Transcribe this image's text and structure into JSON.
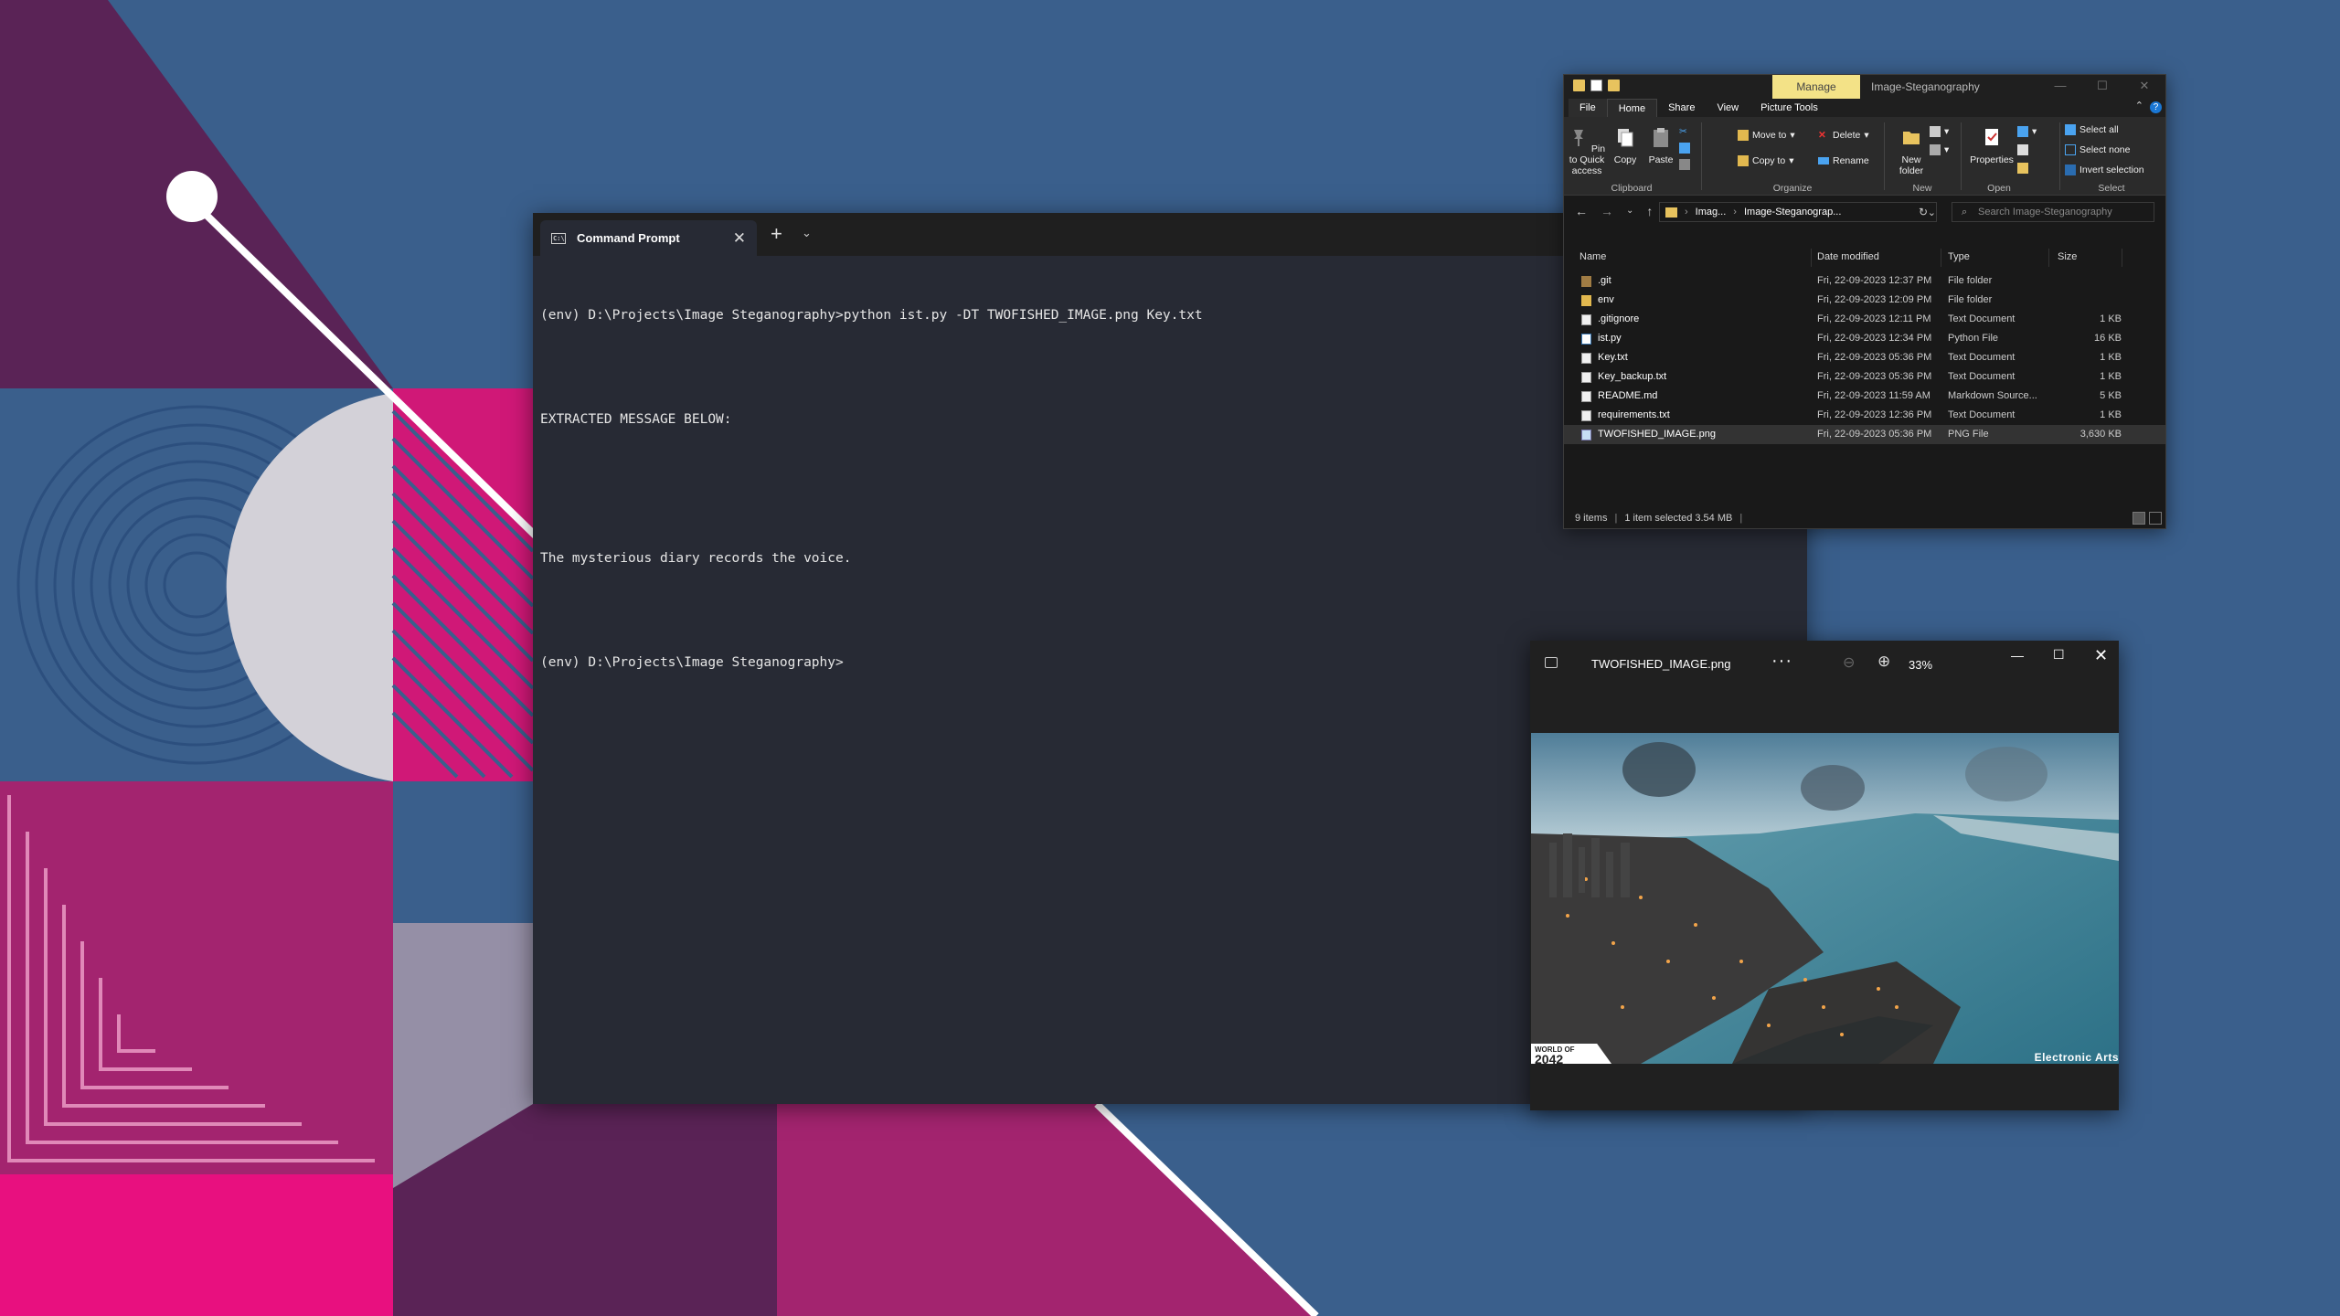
{
  "terminal": {
    "tab_title": "Command Prompt",
    "lines": [
      "(env) D:\\Projects\\Image Steganography>python ist.py -DT TWOFISHED_IMAGE.png Key.txt",
      "EXTRACTED MESSAGE BELOW:",
      "The mysterious diary records the voice.",
      "(env) D:\\Projects\\Image Steganography>"
    ]
  },
  "explorer": {
    "contextual_tab": "Manage",
    "window_title": "Image-Steganography",
    "tabs": [
      "File",
      "Home",
      "Share",
      "View",
      "Picture Tools"
    ],
    "ribbon": {
      "pin": "Pin to Quick access",
      "copy": "Copy",
      "paste": "Paste",
      "move_to": "Move to",
      "copy_to": "Copy to",
      "delete": "Delete",
      "rename": "Rename",
      "new_folder": "New folder",
      "properties": "Properties",
      "select_all": "Select all",
      "select_none": "Select none",
      "invert_selection": "Invert selection",
      "groups": [
        "Clipboard",
        "Organize",
        "New",
        "Open",
        "Select"
      ]
    },
    "address": {
      "crumb1": "Imag...",
      "crumb2": "Image-Steganograp...",
      "search_placeholder": "Search Image-Steganography"
    },
    "columns": [
      "Name",
      "Date modified",
      "Type",
      "Size"
    ],
    "rows": [
      {
        "name": ".git",
        "date": "Fri, 22-09-2023 12:37 PM",
        "type": "File folder",
        "size": "",
        "icon": "folder"
      },
      {
        "name": "env",
        "date": "Fri, 22-09-2023 12:09 PM",
        "type": "File folder",
        "size": "",
        "icon": "folder"
      },
      {
        "name": ".gitignore",
        "date": "Fri, 22-09-2023 12:11 PM",
        "type": "Text Document",
        "size": "1 KB",
        "icon": "doc"
      },
      {
        "name": "ist.py",
        "date": "Fri, 22-09-2023 12:34 PM",
        "type": "Python File",
        "size": "16 KB",
        "icon": "py"
      },
      {
        "name": "Key.txt",
        "date": "Fri, 22-09-2023 05:36 PM",
        "type": "Text Document",
        "size": "1 KB",
        "icon": "doc"
      },
      {
        "name": "Key_backup.txt",
        "date": "Fri, 22-09-2023 05:36 PM",
        "type": "Text Document",
        "size": "1 KB",
        "icon": "doc"
      },
      {
        "name": "README.md",
        "date": "Fri, 22-09-2023 11:59 AM",
        "type": "Markdown Source...",
        "size": "5 KB",
        "icon": "doc"
      },
      {
        "name": "requirements.txt",
        "date": "Fri, 22-09-2023 12:36 PM",
        "type": "Text Document",
        "size": "1 KB",
        "icon": "doc"
      },
      {
        "name": "TWOFISHED_IMAGE.png",
        "date": "Fri, 22-09-2023 05:36 PM",
        "type": "PNG File",
        "size": "3,630 KB",
        "icon": "img"
      }
    ],
    "status": {
      "items": "9 items",
      "selected": "1 item selected  3.54 MB"
    }
  },
  "photos": {
    "filename": "TWOFISHED_IMAGE.png",
    "zoom": "33%",
    "badge_top": "WORLD OF",
    "badge_year": "2042",
    "publisher_text": "Electronic Arts"
  },
  "colors": {
    "desktop_blue": "#3a5f8c",
    "terminal_bg": "#272a34",
    "manage_tab": "#f3e287",
    "magenta": "#e0157d",
    "purple": "#5a2356"
  }
}
